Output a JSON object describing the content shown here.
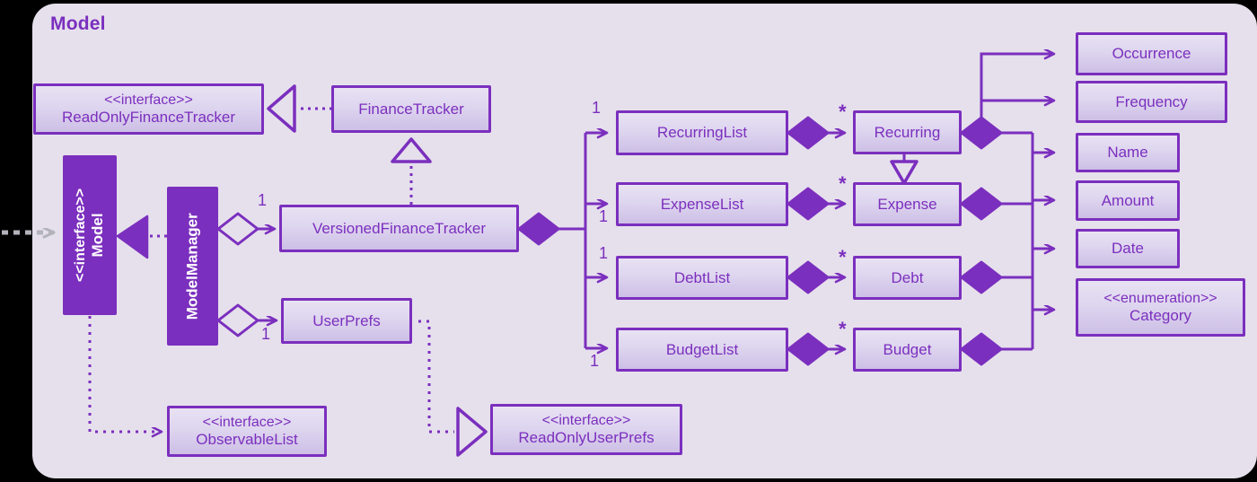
{
  "panel": {
    "title": "Model",
    "background": "#e6e0ec",
    "accent": "#7b2fbe"
  },
  "stereotypes": {
    "interface": "<<interface>>",
    "enumeration": "<<enumeration>>"
  },
  "nodes": [
    {
      "id": "readonlyfinancetracker",
      "stereotype": "<<interface>>",
      "name": "ReadOnlyFinanceTracker",
      "style": "light"
    },
    {
      "id": "financetracker",
      "stereotype": "",
      "name": "FinanceTracker",
      "style": "light"
    },
    {
      "id": "model",
      "stereotype": "<<interface>>",
      "name": "Model",
      "style": "solid"
    },
    {
      "id": "modelmanager",
      "stereotype": "",
      "name": "ModelManager",
      "style": "solid"
    },
    {
      "id": "versionedfinancetracker",
      "stereotype": "",
      "name": "VersionedFinanceTracker",
      "style": "light"
    },
    {
      "id": "userprefs",
      "stereotype": "",
      "name": "UserPrefs",
      "style": "light"
    },
    {
      "id": "observablelist",
      "stereotype": "<<interface>>",
      "name": "ObservableList",
      "style": "light"
    },
    {
      "id": "readonlyuserprefs",
      "stereotype": "<<interface>>",
      "name": "ReadOnlyUserPrefs",
      "style": "light"
    },
    {
      "id": "recurringlist",
      "stereotype": "",
      "name": "RecurringList",
      "style": "light"
    },
    {
      "id": "expenselist",
      "stereotype": "",
      "name": "ExpenseList",
      "style": "light"
    },
    {
      "id": "debtlist",
      "stereotype": "",
      "name": "DebtList",
      "style": "light"
    },
    {
      "id": "budgetlist",
      "stereotype": "",
      "name": "BudgetList",
      "style": "light"
    },
    {
      "id": "recurring",
      "stereotype": "",
      "name": "Recurring",
      "style": "light"
    },
    {
      "id": "expense",
      "stereotype": "",
      "name": "Expense",
      "style": "light"
    },
    {
      "id": "debt",
      "stereotype": "",
      "name": "Debt",
      "style": "light"
    },
    {
      "id": "budget",
      "stereotype": "",
      "name": "Budget",
      "style": "light"
    },
    {
      "id": "occurrence",
      "stereotype": "",
      "name": "Occurrence",
      "style": "light"
    },
    {
      "id": "frequency",
      "stereotype": "",
      "name": "Frequency",
      "style": "light"
    },
    {
      "id": "nameattr",
      "stereotype": "",
      "name": "Name",
      "style": "light"
    },
    {
      "id": "amount",
      "stereotype": "",
      "name": "Amount",
      "style": "light"
    },
    {
      "id": "date",
      "stereotype": "",
      "name": "Date",
      "style": "light"
    },
    {
      "id": "category",
      "stereotype": "<<enumeration>>",
      "name": "Category",
      "style": "light"
    }
  ],
  "multiplicities": {
    "versioned_one": "1",
    "userprefs_one": "1",
    "recurringlist_one": "1",
    "expenselist_one": "1",
    "debtlist_one": "1",
    "budgetlist_one": "1",
    "recurring_star": "*",
    "expense_star": "*",
    "debt_star": "*",
    "budget_star": "*"
  },
  "relationships": [
    {
      "from": "financetracker",
      "to": "readonlyfinancetracker",
      "type": "realization"
    },
    {
      "from": "versionedfinancetracker",
      "to": "financetracker",
      "type": "realization"
    },
    {
      "from": "modelmanager",
      "to": "model",
      "type": "realization"
    },
    {
      "from": "modelmanager",
      "to": "versionedfinancetracker",
      "type": "aggregation"
    },
    {
      "from": "modelmanager",
      "to": "userprefs",
      "type": "aggregation"
    },
    {
      "from": "model",
      "to": "observablelist",
      "type": "dependency"
    },
    {
      "from": "userprefs",
      "to": "readonlyuserprefs",
      "type": "realization"
    },
    {
      "from": "versionedfinancetracker",
      "to": "recurringlist",
      "type": "composition"
    },
    {
      "from": "versionedfinancetracker",
      "to": "expenselist",
      "type": "composition"
    },
    {
      "from": "versionedfinancetracker",
      "to": "debtlist",
      "type": "composition"
    },
    {
      "from": "versionedfinancetracker",
      "to": "budgetlist",
      "type": "composition"
    },
    {
      "from": "recurringlist",
      "to": "recurring",
      "type": "composition"
    },
    {
      "from": "expenselist",
      "to": "expense",
      "type": "composition"
    },
    {
      "from": "debtlist",
      "to": "debt",
      "type": "composition"
    },
    {
      "from": "budgetlist",
      "to": "budget",
      "type": "composition"
    },
    {
      "from": "recurring",
      "to": "expense",
      "type": "generalization"
    },
    {
      "from": "recurring",
      "to": "occurrence",
      "type": "composition"
    },
    {
      "from": "recurring",
      "to": "frequency",
      "type": "composition"
    },
    {
      "from": "recurring",
      "to": "nameattr",
      "type": "composition"
    },
    {
      "from": "expense",
      "to": "amount",
      "type": "composition"
    },
    {
      "from": "debt",
      "to": "date",
      "type": "composition"
    },
    {
      "from": "budget",
      "to": "category",
      "type": "composition"
    }
  ]
}
